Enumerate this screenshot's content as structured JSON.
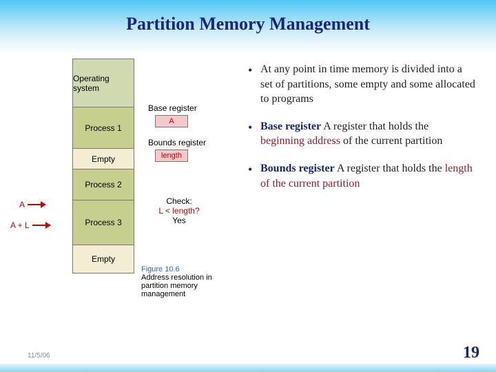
{
  "title": "Partition Memory Management",
  "mem": {
    "os": "Operating system",
    "p1": "Process 1",
    "e1": "Empty",
    "p2": "Process 2",
    "p3": "Process 3",
    "e2": "Empty"
  },
  "regs": {
    "base_label": "Base register",
    "base_value": "A",
    "bounds_label": "Bounds register",
    "bounds_value": "length"
  },
  "check": {
    "label": "Check:",
    "expr": "L < length?",
    "result": "Yes"
  },
  "pointers": {
    "a": "A",
    "al": "A + L"
  },
  "figcap": {
    "num": "Figure 10.6",
    "text": "Address resolution in partition memory management"
  },
  "bullets": {
    "b1": "At any point in time memory is divided into a set of partitions, some empty and some allocated to programs",
    "b2_term": "Base register",
    "b2_a": "  A register that holds the ",
    "b2_hl": "beginning address",
    "b2_b": " of the current partition",
    "b3_term": "Bounds register",
    "b3_a": "  A register that holds the ",
    "b3_hl": "length of the current partition"
  },
  "slidenum": "19",
  "date": "11/5/06"
}
